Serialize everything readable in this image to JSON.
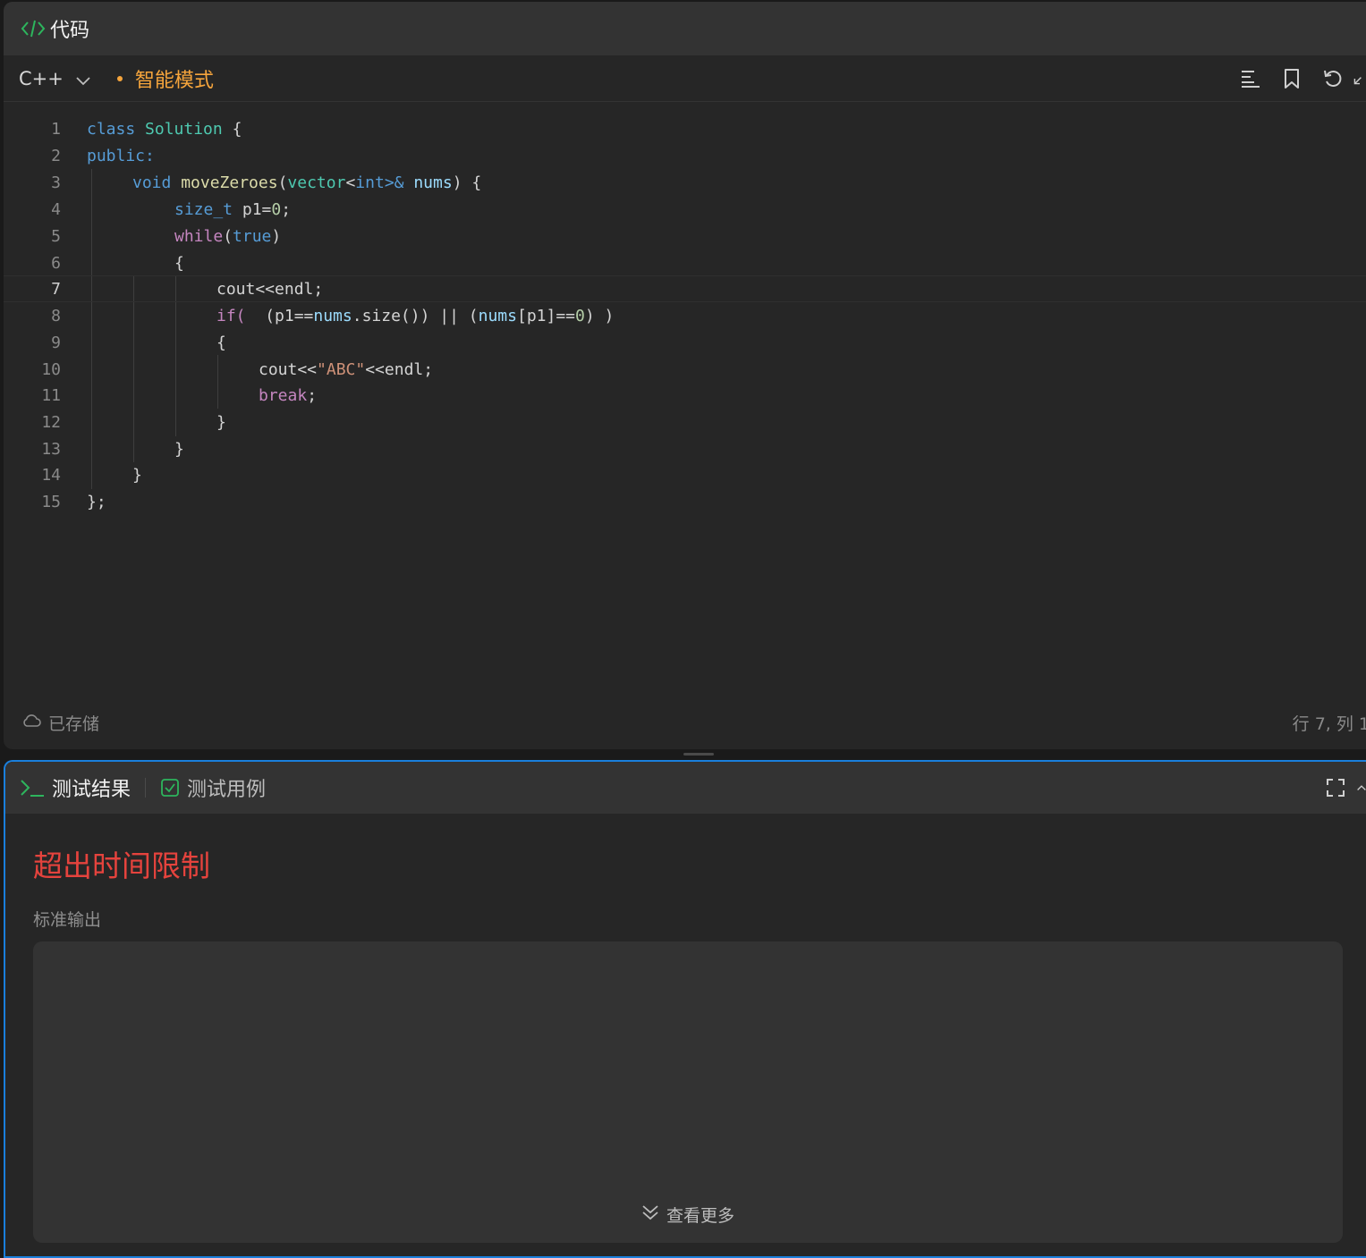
{
  "code_panel": {
    "title": "代码",
    "title_icon": "code-brackets-icon",
    "language": "C++",
    "mode": "智能模式",
    "toolbar_icons": [
      "format-icon",
      "bookmark-icon",
      "reset-icon",
      "collapse-icon"
    ],
    "status_saved": "已存储",
    "status_position": "行 7, 列 1",
    "active_line": 7
  },
  "code_lines": [
    "1",
    "2",
    "3",
    "4",
    "5",
    "6",
    "7",
    "8",
    "9",
    "10",
    "11",
    "12",
    "13",
    "14",
    "15"
  ],
  "tokens": {
    "l1_class": "class",
    "l1_name": "Solution",
    "l1_brace": "{",
    "l2_public": "public:",
    "l3_void": "void",
    "l3_fn": "moveZeroes",
    "l3_open": "(",
    "l3_vector": "vector",
    "l3_lt": "<",
    "l3_int": "int",
    "l3_gtamp": ">&",
    "l3_nums": "nums",
    "l3_close": ") {",
    "l4_type": "size_t",
    "l4_rest": "p1=",
    "l4_zero": "0",
    "l4_semi": ";",
    "l5_while": "while",
    "l5_open": "(",
    "l5_true": "true",
    "l5_close": ")",
    "l6_brace": "{",
    "l7_text": "cout<<endl;",
    "l8_if": "if(",
    "l8_a": "  (p1==",
    "l8_nums": "nums",
    "l8_b": ".size()) || (",
    "l8_nums2": "nums",
    "l8_c": "[p1]==",
    "l8_zero": "0",
    "l8_d": ") )",
    "l9_brace": "{",
    "l10_a": "cout<<",
    "l10_str": "\"ABC\"",
    "l10_b": "<<endl;",
    "l11_break": "break",
    "l11_semi": ";",
    "l12_brace": "}",
    "l13_brace": "}",
    "l14_brace": "}",
    "l15_end": "};"
  },
  "result_panel": {
    "tabs": [
      {
        "label": "测试结果",
        "icon": "terminal-icon",
        "active": true
      },
      {
        "label": "测试用例",
        "icon": "checkbox-icon",
        "active": false
      }
    ],
    "toolbar_icons": [
      "fullscreen-icon",
      "collapse-up-icon"
    ],
    "verdict": "超出时间限制",
    "stdout_label": "标准输出",
    "stdout_value": "",
    "more_label": "查看更多"
  },
  "colors": {
    "accent_blue": "#1a7fdc",
    "green_icon": "#2db55d",
    "mode_orange": "#f6a53c",
    "error_red": "#e5433d"
  }
}
